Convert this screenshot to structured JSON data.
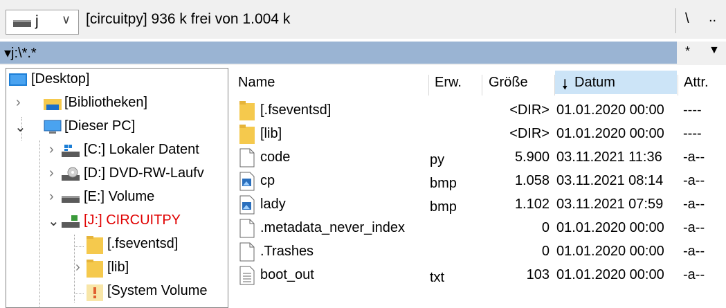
{
  "drive": {
    "letter": "j",
    "chevron_icon": "chevron-down-icon",
    "info": "[circuitpy]  936 k frei von 1.004 k",
    "root_label": "\\",
    "up_label": ".."
  },
  "path": {
    "text": "▾j:\\*.*",
    "history_label": "*",
    "menu_label": "▼"
  },
  "colors": {
    "path_bg": "#9ab4d3",
    "sort_header_bg": "#cce4f7",
    "folder": "#f5c94d",
    "highlight_text": "#e00000"
  },
  "tree": {
    "items": [
      {
        "label": "[Desktop]",
        "icon": "desktop-icon",
        "twisty": ""
      },
      {
        "label": "[Bibliotheken]",
        "icon": "library-icon",
        "twisty": "›"
      },
      {
        "label": "[Dieser PC]",
        "icon": "computer-icon",
        "twisty": "⌄"
      },
      {
        "label": "[C:]  Lokaler Datent",
        "icon": "system-drive-icon",
        "twisty": "›"
      },
      {
        "label": "[D:]  DVD-RW-Laufv",
        "icon": "dvd-drive-icon",
        "twisty": "›"
      },
      {
        "label": "[E:]  Volume",
        "icon": "drive-icon",
        "twisty": "›"
      },
      {
        "label": "[J:]  CIRCUITPY",
        "icon": "usb-drive-icon",
        "twisty": "⌄"
      },
      {
        "label": "[.fseventsd]",
        "icon": "folder-icon",
        "twisty": ""
      },
      {
        "label": "[lib]",
        "icon": "folder-icon",
        "twisty": "›"
      },
      {
        "label": "[System Volume",
        "icon": "restricted-folder-icon",
        "twisty": ""
      }
    ]
  },
  "list": {
    "columns": {
      "name": "Name",
      "ext": "Erw.",
      "size": "Größe",
      "date": "Datum",
      "attr": "Attr.",
      "sort_icon": "sort-down-arrow-icon"
    },
    "rows": [
      {
        "name": "[.fseventsd]",
        "ext": "",
        "size": "<DIR>",
        "date": "01.01.2020 00:00",
        "attr": "----",
        "icon": "folder-icon"
      },
      {
        "name": "[lib]",
        "ext": "",
        "size": "<DIR>",
        "date": "01.01.2020 00:00",
        "attr": "----",
        "icon": "folder-icon"
      },
      {
        "name": "code",
        "ext": "py",
        "size": "5.900",
        "date": "03.11.2021 11:36",
        "attr": "-a--",
        "icon": "file-icon"
      },
      {
        "name": "cp",
        "ext": "bmp",
        "size": "1.058",
        "date": "03.11.2021 08:14",
        "attr": "-a--",
        "icon": "image-file-icon"
      },
      {
        "name": "lady",
        "ext": "bmp",
        "size": "1.102",
        "date": "03.11.2021 07:59",
        "attr": "-a--",
        "icon": "image-file-icon"
      },
      {
        "name": ".metadata_never_index",
        "ext": "",
        "size": "0",
        "date": "01.01.2020 00:00",
        "attr": "-a--",
        "icon": "file-icon"
      },
      {
        "name": ".Trashes",
        "ext": "",
        "size": "0",
        "date": "01.01.2020 00:00",
        "attr": "-a--",
        "icon": "file-icon"
      },
      {
        "name": "boot_out",
        "ext": "txt",
        "size": "103",
        "date": "01.01.2020 00:00",
        "attr": "-a--",
        "icon": "text-file-icon"
      }
    ]
  }
}
